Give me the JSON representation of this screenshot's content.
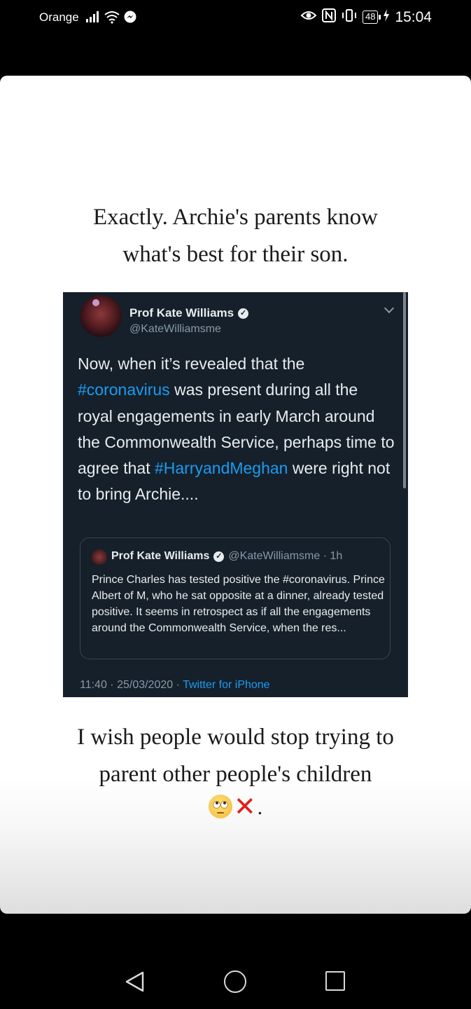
{
  "status_bar": {
    "carrier": "Orange",
    "battery": "48",
    "time": "15:04"
  },
  "story": {
    "caption_top_line1": "Exactly. Archie's parents know",
    "caption_top_line2": "what's best for their son.",
    "caption_bottom_line1": "I wish people would stop trying to",
    "caption_bottom_line2": "parent other people's children",
    "caption_bottom_end": "."
  },
  "tweet": {
    "author_name": "Prof Kate Williams",
    "author_handle": "@KateWilliamsme",
    "body_part1": "Now, when it’s revealed that the ",
    "hashtag1": "#coronavirus",
    "body_part2": " was present during all the royal engagements in early March around the Commonwealth Service, perhaps time to agree that ",
    "hashtag2": "#HarryandMeghan",
    "body_part3": " were right not to bring Archie....",
    "quote": {
      "author_name": "Prof Kate Williams",
      "meta": "@KateWilliamsme · 1h",
      "body": "Prince Charles has tested positive  the #coronavirus. Prince Albert of M, who he sat opposite at a dinner, already tested positive. It seems in retrospect as if all the engagements around the Commonwealth Service, when the res..."
    },
    "timestamp": "11:40 · 25/03/2020 · ",
    "source": "Twitter for iPhone"
  },
  "icons": {
    "status_left": [
      "signal-icon",
      "wifi-icon",
      "messenger-icon"
    ],
    "status_right": [
      "eye-icon",
      "nfc-icon",
      "vibrate-icon",
      "battery-icon",
      "charging-icon"
    ],
    "emoji": [
      "eye-roll-emoji",
      "cross-mark-emoji"
    ],
    "nav": [
      "back-icon",
      "home-icon",
      "recents-icon"
    ]
  }
}
